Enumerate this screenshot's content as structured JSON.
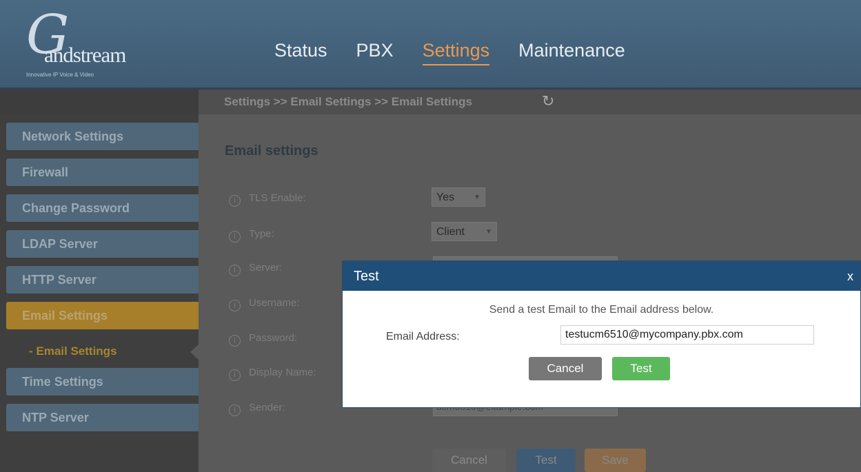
{
  "logo": {
    "name": "andstream",
    "tagline": "Innovative IP Voice & Video"
  },
  "nav": [
    {
      "label": "Status"
    },
    {
      "label": "PBX"
    },
    {
      "label": "Settings"
    },
    {
      "label": "Maintenance"
    }
  ],
  "breadcrumb": "Settings >> Email Settings >> Email Settings",
  "sidebar": {
    "items": [
      {
        "label": "Network Settings"
      },
      {
        "label": "Firewall"
      },
      {
        "label": "Change Password"
      },
      {
        "label": "LDAP Server"
      },
      {
        "label": "HTTP Server"
      },
      {
        "label": "Email Settings"
      },
      {
        "label": "Time Settings"
      },
      {
        "label": "NTP Server"
      }
    ],
    "sub_item": "- Email Settings"
  },
  "form": {
    "title": "Email settings",
    "fields": [
      {
        "label": "TLS Enable:",
        "value": "Yes"
      },
      {
        "label": "Type:",
        "value": "Client"
      },
      {
        "label": "Server:"
      },
      {
        "label": "Username:"
      },
      {
        "label": "Password:"
      },
      {
        "label": "Display Name:"
      },
      {
        "label": "Sender:",
        "value": "ucm6510@example.com"
      }
    ],
    "buttons": {
      "cancel": "Cancel",
      "test": "Test",
      "save": "Save"
    }
  },
  "dialog": {
    "title": "Test",
    "close": "x",
    "description": "Send a test Email to the Email address below.",
    "email_label": "Email Address:",
    "email_value": "testucm6510@mycompany.pbx.com",
    "cancel_label": "Cancel",
    "test_label": "Test"
  },
  "colors": {
    "accent": "#e89a52",
    "dialog_header": "#1f4e78",
    "test_button": "#5cb85c",
    "cancel_button": "#777777"
  }
}
